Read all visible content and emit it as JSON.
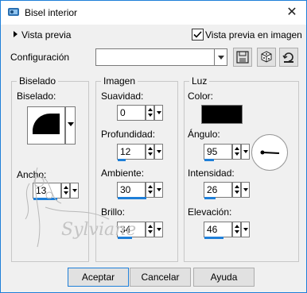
{
  "window": {
    "title": "Bisel interior",
    "close_glyph": "✕"
  },
  "preview": {
    "toggle_label": "Vista previa",
    "checkbox_label": "Vista previa en imagen",
    "checked": true
  },
  "config": {
    "label": "Configuración",
    "value": ""
  },
  "groups": {
    "biselado": {
      "title": "Biselado",
      "bevel_label": "Biselado:",
      "width_label": "Ancho:",
      "width_value": "13"
    },
    "imagen": {
      "title": "Imagen",
      "smoothness_label": "Suavidad:",
      "smoothness_value": "0",
      "depth_label": "Profundidad:",
      "depth_value": "12",
      "ambience_label": "Ambiente:",
      "ambience_value": "30",
      "shine_label": "Brillo:",
      "shine_value": "34"
    },
    "luz": {
      "title": "Luz",
      "color_label": "Color:",
      "color_value": "#000000",
      "angle_label": "Ángulo:",
      "angle_value": "95",
      "intensity_label": "Intensidad:",
      "intensity_value": "26",
      "elevation_label": "Elevación:",
      "elevation_value": "46"
    }
  },
  "buttons": {
    "ok": "Aceptar",
    "cancel": "Cancelar",
    "help": "Ayuda"
  },
  "watermark": {
    "text": "Sylviane"
  },
  "colors": {
    "accent": "#1e7fd8",
    "slider": "#1e7fd8"
  }
}
